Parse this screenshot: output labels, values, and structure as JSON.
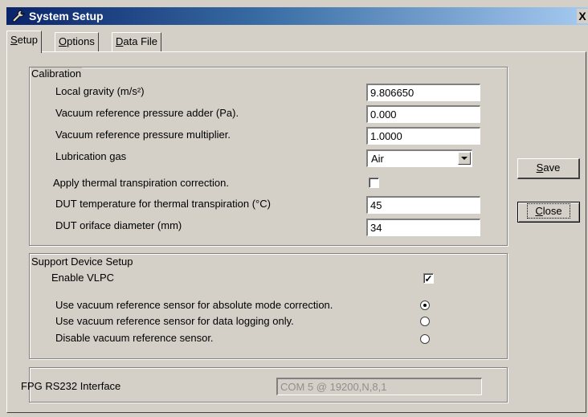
{
  "window": {
    "title": "System Setup",
    "close_label": "X"
  },
  "tabs": [
    {
      "label": "Setup",
      "mnemonic": "S",
      "rest": "etup",
      "active": true
    },
    {
      "label": "Options",
      "mnemonic": "O",
      "rest": "ptions",
      "active": false
    },
    {
      "label": "Data File",
      "mnemonic": "D",
      "rest": "ata File",
      "active": false
    }
  ],
  "calibration": {
    "title": "Calibration",
    "gravity_label": "Local gravity (m/s²)",
    "gravity_value": "9.806650",
    "adder_label": "Vacuum reference pressure adder (Pa).",
    "adder_value": "0.000",
    "multiplier_label": "Vacuum reference pressure multiplier.",
    "multiplier_value": "1.0000",
    "gas_label": "Lubrication gas",
    "gas_value": "Air",
    "thermal_label": "Apply thermal transpiration correction.",
    "thermal_checked": false,
    "dut_temp_label": "DUT temperature for thermal transpiration (°C)",
    "dut_temp_value": "45",
    "dut_diam_label": "DUT oriface diameter (mm)",
    "dut_diam_value": "34"
  },
  "support": {
    "title": "Support Device Setup",
    "vlpc_label": "Enable VLPC",
    "vlpc_checked": true,
    "vlpc_mark": "✓",
    "radio_abs_label": "Use vacuum reference sensor for absolute mode correction.",
    "radio_log_label": "Use vacuum reference sensor for data logging only.",
    "radio_disable_label": "Disable vacuum reference sensor.",
    "selected_radio": "abs"
  },
  "rs232": {
    "label": "FPG RS232 Interface",
    "value": "COM 5 @ 19200,N,8,1"
  },
  "buttons": {
    "save_mnemonic": "S",
    "save_rest": "ave",
    "close_mnemonic": "C",
    "close_rest": "lose"
  }
}
